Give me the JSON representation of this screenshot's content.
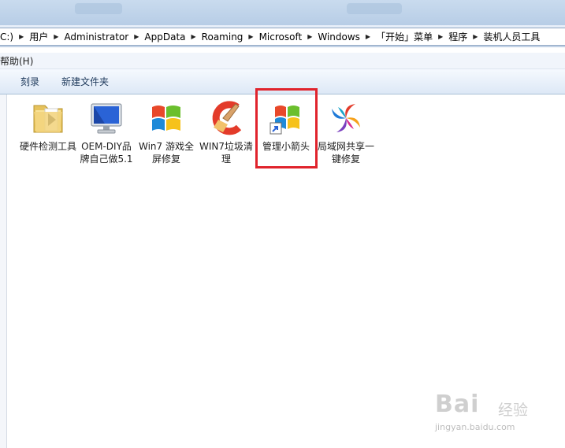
{
  "address": {
    "crumbs": [
      "C:)",
      "用户",
      "Administrator",
      "AppData",
      "Roaming",
      "Microsoft",
      "Windows",
      "「开始」菜单",
      "程序",
      "装机人员工具"
    ]
  },
  "menu": {
    "help": "帮助(H)"
  },
  "toolbar": {
    "burn": "刻录",
    "new_folder": "新建文件夹"
  },
  "items": [
    {
      "label": "硬件检测工具",
      "icon": "folder-icon"
    },
    {
      "label": "OEM-DIY品牌自己做5.1",
      "icon": "monitor-icon"
    },
    {
      "label": "Win7 游戏全屏修复",
      "icon": "windows-flag-icon"
    },
    {
      "label": "WIN7垃圾清理",
      "icon": "ccleaner-icon"
    },
    {
      "label": "管理小箭头",
      "icon": "windows-shortcut-icon"
    },
    {
      "label": "局域网共享一键修复",
      "icon": "share-swirl-icon"
    }
  ],
  "watermark": {
    "brand": "Bai",
    "brand2": "经验",
    "url": "jingyan.baidu.com"
  },
  "colors": {
    "highlight": "#e0232c",
    "toolbar_text": "#1e395b"
  }
}
